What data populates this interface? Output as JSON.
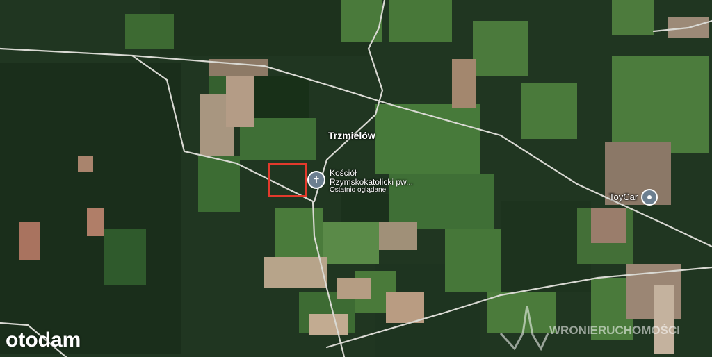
{
  "map": {
    "village_label": "Trzmielów",
    "places": [
      {
        "name_line1": "Kościół",
        "name_line2": "Rzymskokatolicki pw...",
        "subtitle": "Ostatnio oglądane",
        "icon": "cross-icon"
      },
      {
        "name": "ToyCar",
        "icon": "place-pin-icon"
      }
    ],
    "marker": {
      "color": "#e23a2c",
      "shape": "rectangle-outline"
    }
  },
  "branding": {
    "portal_logo": "otodam",
    "agency_watermark": "WRONIERUCHOMOŚCI"
  },
  "colors": {
    "forest": "#1f3520",
    "field": "#3f6a33",
    "road": "#d8d8d8",
    "marker": "#e23a2c"
  }
}
